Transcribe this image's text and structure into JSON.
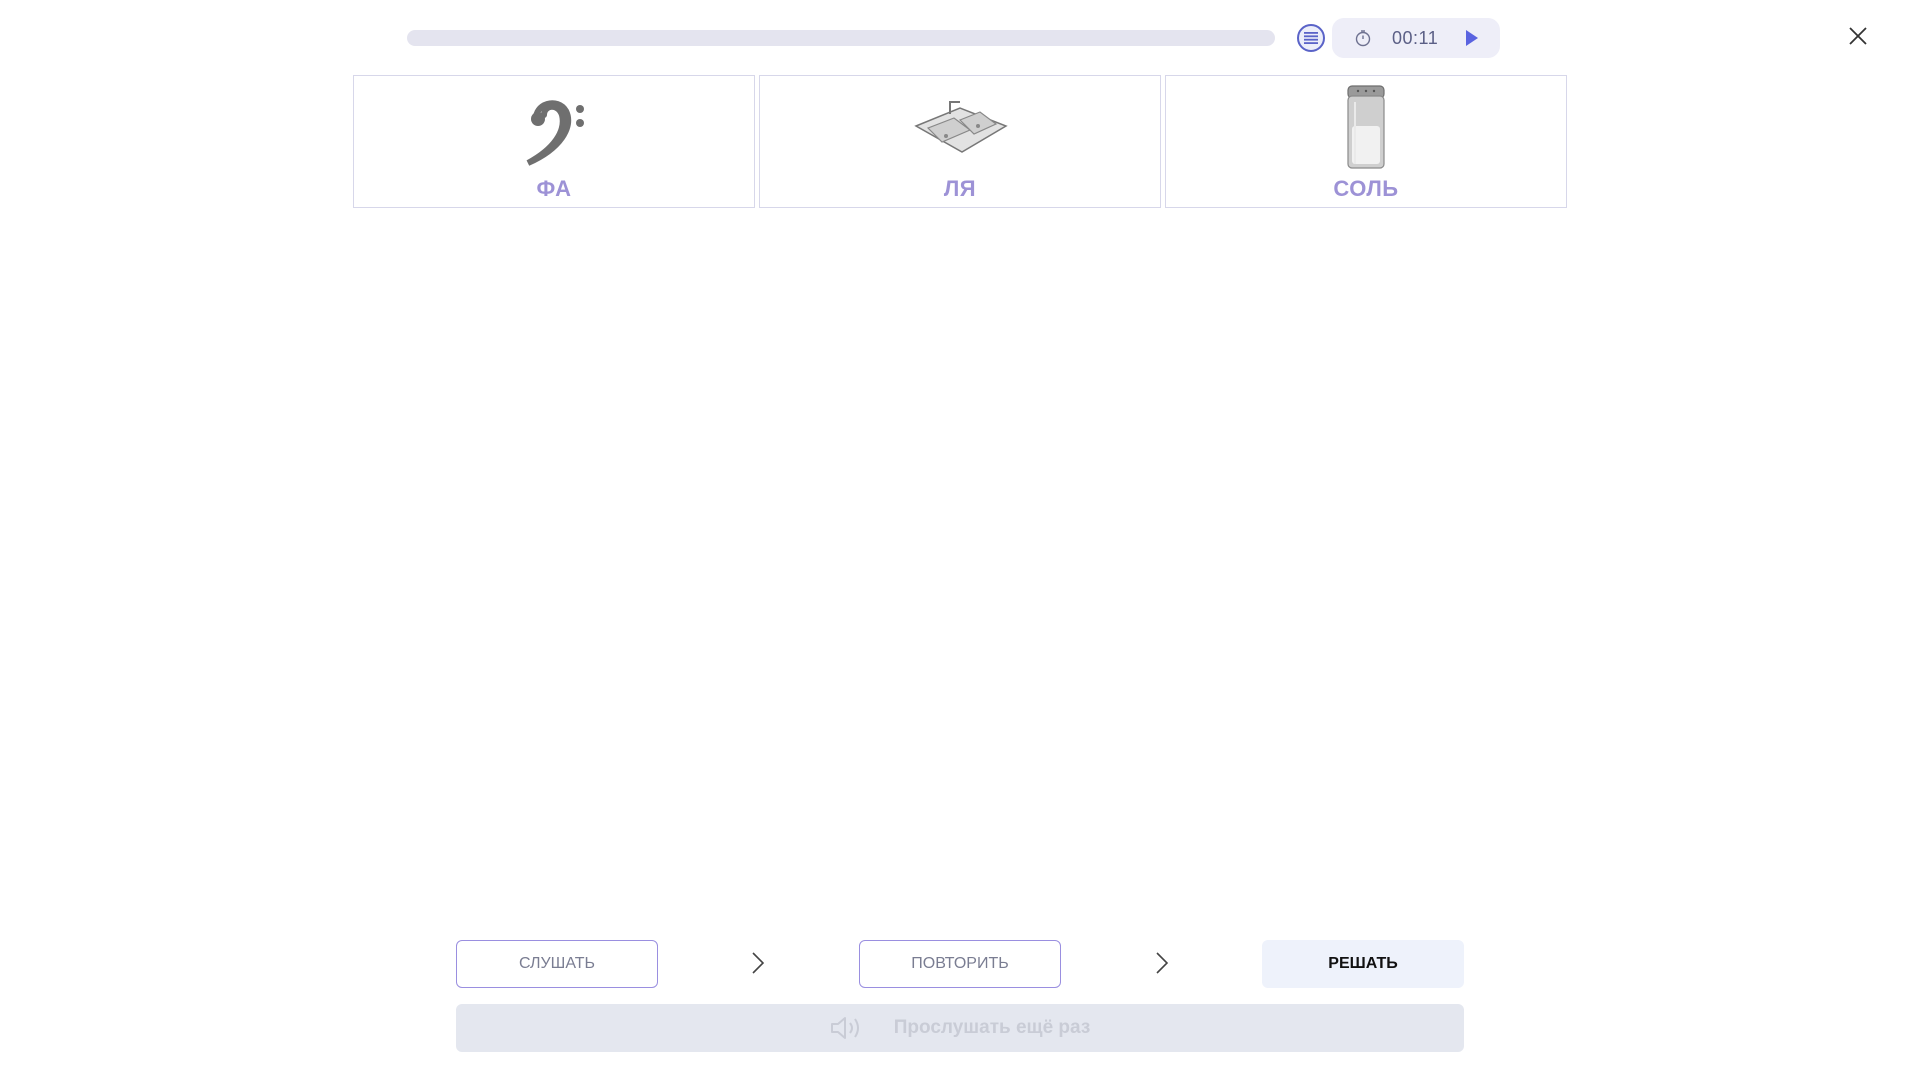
{
  "header": {
    "progress_fraction": 0.0,
    "timer": "00:11",
    "icons": {
      "list": "list-icon",
      "timer": "stopwatch-icon",
      "play": "play-icon",
      "close": "close-icon"
    }
  },
  "cards": [
    {
      "label": "ФА",
      "image": "bass-clef-image"
    },
    {
      "label": "ЛЯ",
      "image": "sink-image"
    },
    {
      "label": "СОЛЬ",
      "image": "salt-shaker-image"
    }
  ],
  "steps": {
    "listen": "СЛУШАТЬ",
    "repeat": "ПОВТОРИТЬ",
    "solve": "РЕШАТЬ"
  },
  "listen_again": {
    "label": "Прослушать ещё раз",
    "icon": "speaker-icon"
  },
  "colors": {
    "accent": "#5a63c8",
    "card_label": "#9d92d6",
    "progress_track": "#e4e4ef"
  }
}
